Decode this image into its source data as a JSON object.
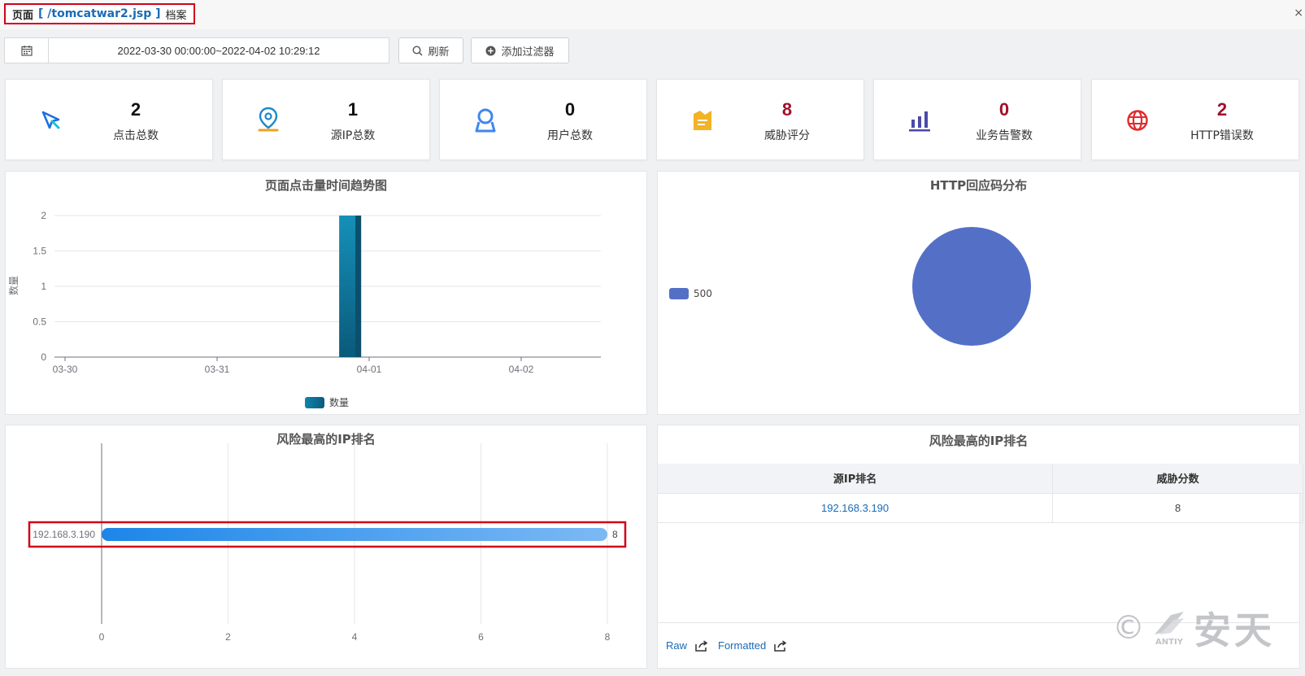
{
  "header": {
    "prefix": "页面",
    "path": "[ /tomcatwar2.jsp ]",
    "suffix": "档案",
    "close_glyph": "×"
  },
  "toolbar": {
    "date_range": "2022-03-30 00:00:00~2022-04-02 10:29:12",
    "refresh_label": "刷新",
    "add_filter_label": "添加过滤器"
  },
  "stats": [
    {
      "value": "2",
      "label": "点击总数",
      "icon": "cursor-icon"
    },
    {
      "value": "1",
      "label": "源IP总数",
      "icon": "location-pin-icon"
    },
    {
      "value": "0",
      "label": "用户总数",
      "icon": "user-icon"
    },
    {
      "value": "8",
      "label": "威胁评分",
      "icon": "threat-score-icon"
    },
    {
      "value": "0",
      "label": "业务告警数",
      "icon": "bar-chart-icon"
    },
    {
      "value": "2",
      "label": "HTTP错误数",
      "icon": "globe-icon"
    }
  ],
  "colors": {
    "accent_blue": "#1a6bb5",
    "alert_red": "#a0102a",
    "highlight_border": "#d0021b",
    "pie_blue": "#5470c6",
    "bar_teal": "#0e6c94"
  },
  "trend_chart": {
    "title": "页面点击量时间趋势图",
    "ylabel": "数量",
    "legend": "数量"
  },
  "pie_chart": {
    "title": "HTTP回应码分布",
    "legend": "500"
  },
  "ip_bar_chart": {
    "title": "风险最高的IP排名"
  },
  "ip_table": {
    "title": "风险最高的IP排名",
    "columns": [
      "源IP排名",
      "威胁分数"
    ],
    "rows": [
      {
        "ip": "192.168.3.190",
        "score": "8"
      }
    ],
    "raw_label": "Raw",
    "formatted_label": "Formatted"
  },
  "watermark": {
    "brand": "安天",
    "sub": "ANTIY",
    "copyright": "©"
  },
  "chart_data": [
    {
      "type": "bar",
      "title": "页面点击量时间趋势图",
      "ylabel": "数量",
      "xlabel": "",
      "x_ticks": [
        "03-30",
        "03-31",
        "04-01",
        "04-02"
      ],
      "y_ticks": [
        "0",
        "0.5",
        "1",
        "1.5",
        "2"
      ],
      "ylim": [
        0,
        2
      ],
      "series": [
        {
          "name": "数量",
          "points": [
            {
              "x": "2022-03-31 21:00",
              "y": 2
            }
          ]
        }
      ],
      "legend": "bottom-center",
      "grid": true
    },
    {
      "type": "pie",
      "title": "HTTP回应码分布",
      "slices": [
        {
          "label": "500",
          "value": 2
        }
      ],
      "legend": "left"
    },
    {
      "type": "bar",
      "orientation": "horizontal",
      "title": "风险最高的IP排名",
      "categories": [
        "192.168.3.190"
      ],
      "values": [
        8
      ],
      "x_ticks": [
        "0",
        "2",
        "4",
        "6",
        "8"
      ],
      "xlim": [
        0,
        8
      ],
      "grid": true
    }
  ]
}
